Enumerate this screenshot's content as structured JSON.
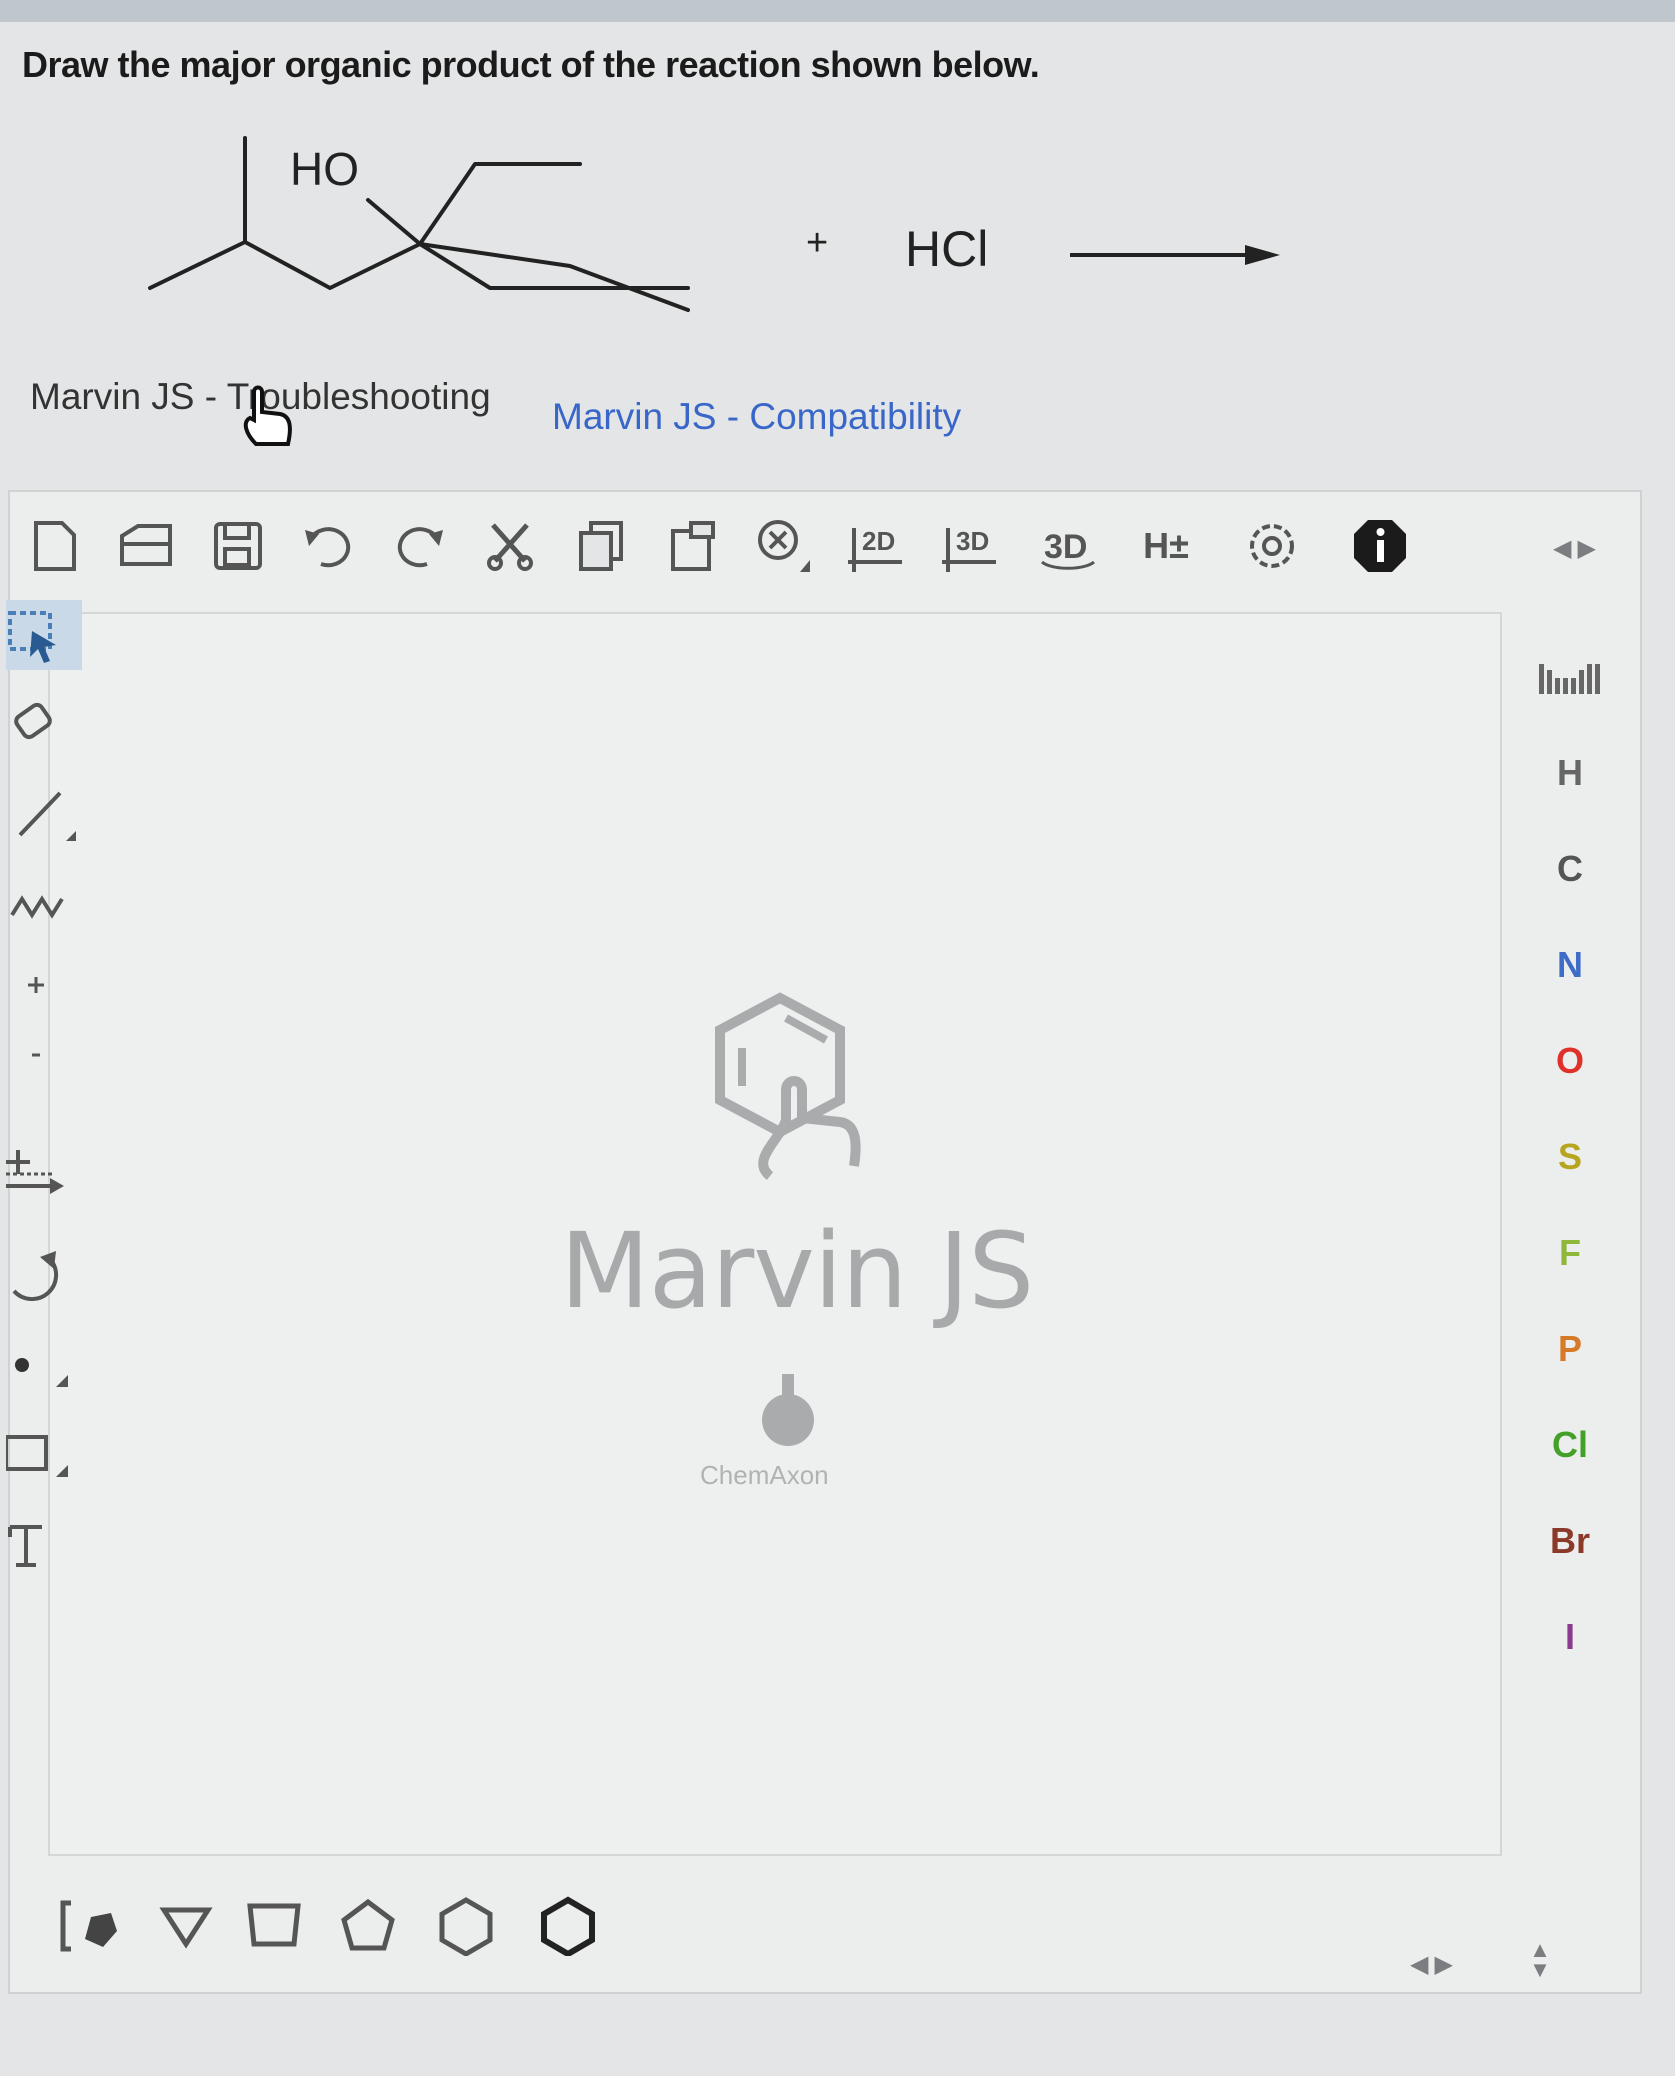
{
  "question": {
    "text": "Draw the major organic product of the reaction shown below.",
    "substituent_label": "HO",
    "plus": "+",
    "reagent": "HCl"
  },
  "links": {
    "troubleshooting": "Marvin JS - Troubleshooting",
    "compatibility": "Marvin JS - Compatibility"
  },
  "toolbar": {
    "icons": [
      "new-document-icon",
      "open-icon",
      "save-icon",
      "undo-icon",
      "redo-icon",
      "cut-icon",
      "copy-icon",
      "paste-icon",
      "zoom-icon",
      "clean-2d-icon",
      "clean-3d-icon",
      "3d-rotate-icon",
      "add-remove-hydrogens-icon",
      "settings-icon",
      "info-icon"
    ],
    "clean2d": "2D",
    "clean3d": "3D",
    "view3d": "3D",
    "hydrogens": "H±"
  },
  "periodic": {
    "elements": [
      {
        "symbol": "H",
        "color": "#666666"
      },
      {
        "symbol": "C",
        "color": "#555555"
      },
      {
        "symbol": "N",
        "color": "#3e6dc9"
      },
      {
        "symbol": "O",
        "color": "#e0302a"
      },
      {
        "symbol": "S",
        "color": "#b7a520"
      },
      {
        "symbol": "F",
        "color": "#8fb83a"
      },
      {
        "symbol": "P",
        "color": "#d67a27"
      },
      {
        "symbol": "Cl",
        "color": "#43a12a"
      },
      {
        "symbol": "Br",
        "color": "#8b3a2a"
      },
      {
        "symbol": "I",
        "color": "#8b3a8f"
      }
    ]
  },
  "canvas": {
    "logo_text": "Marvin JS",
    "company": "ChemAxon"
  },
  "colors": {
    "accent_blue": "#3866c9",
    "toolbar_icon": "#555555",
    "selected_tool": "#c9d9e8"
  }
}
